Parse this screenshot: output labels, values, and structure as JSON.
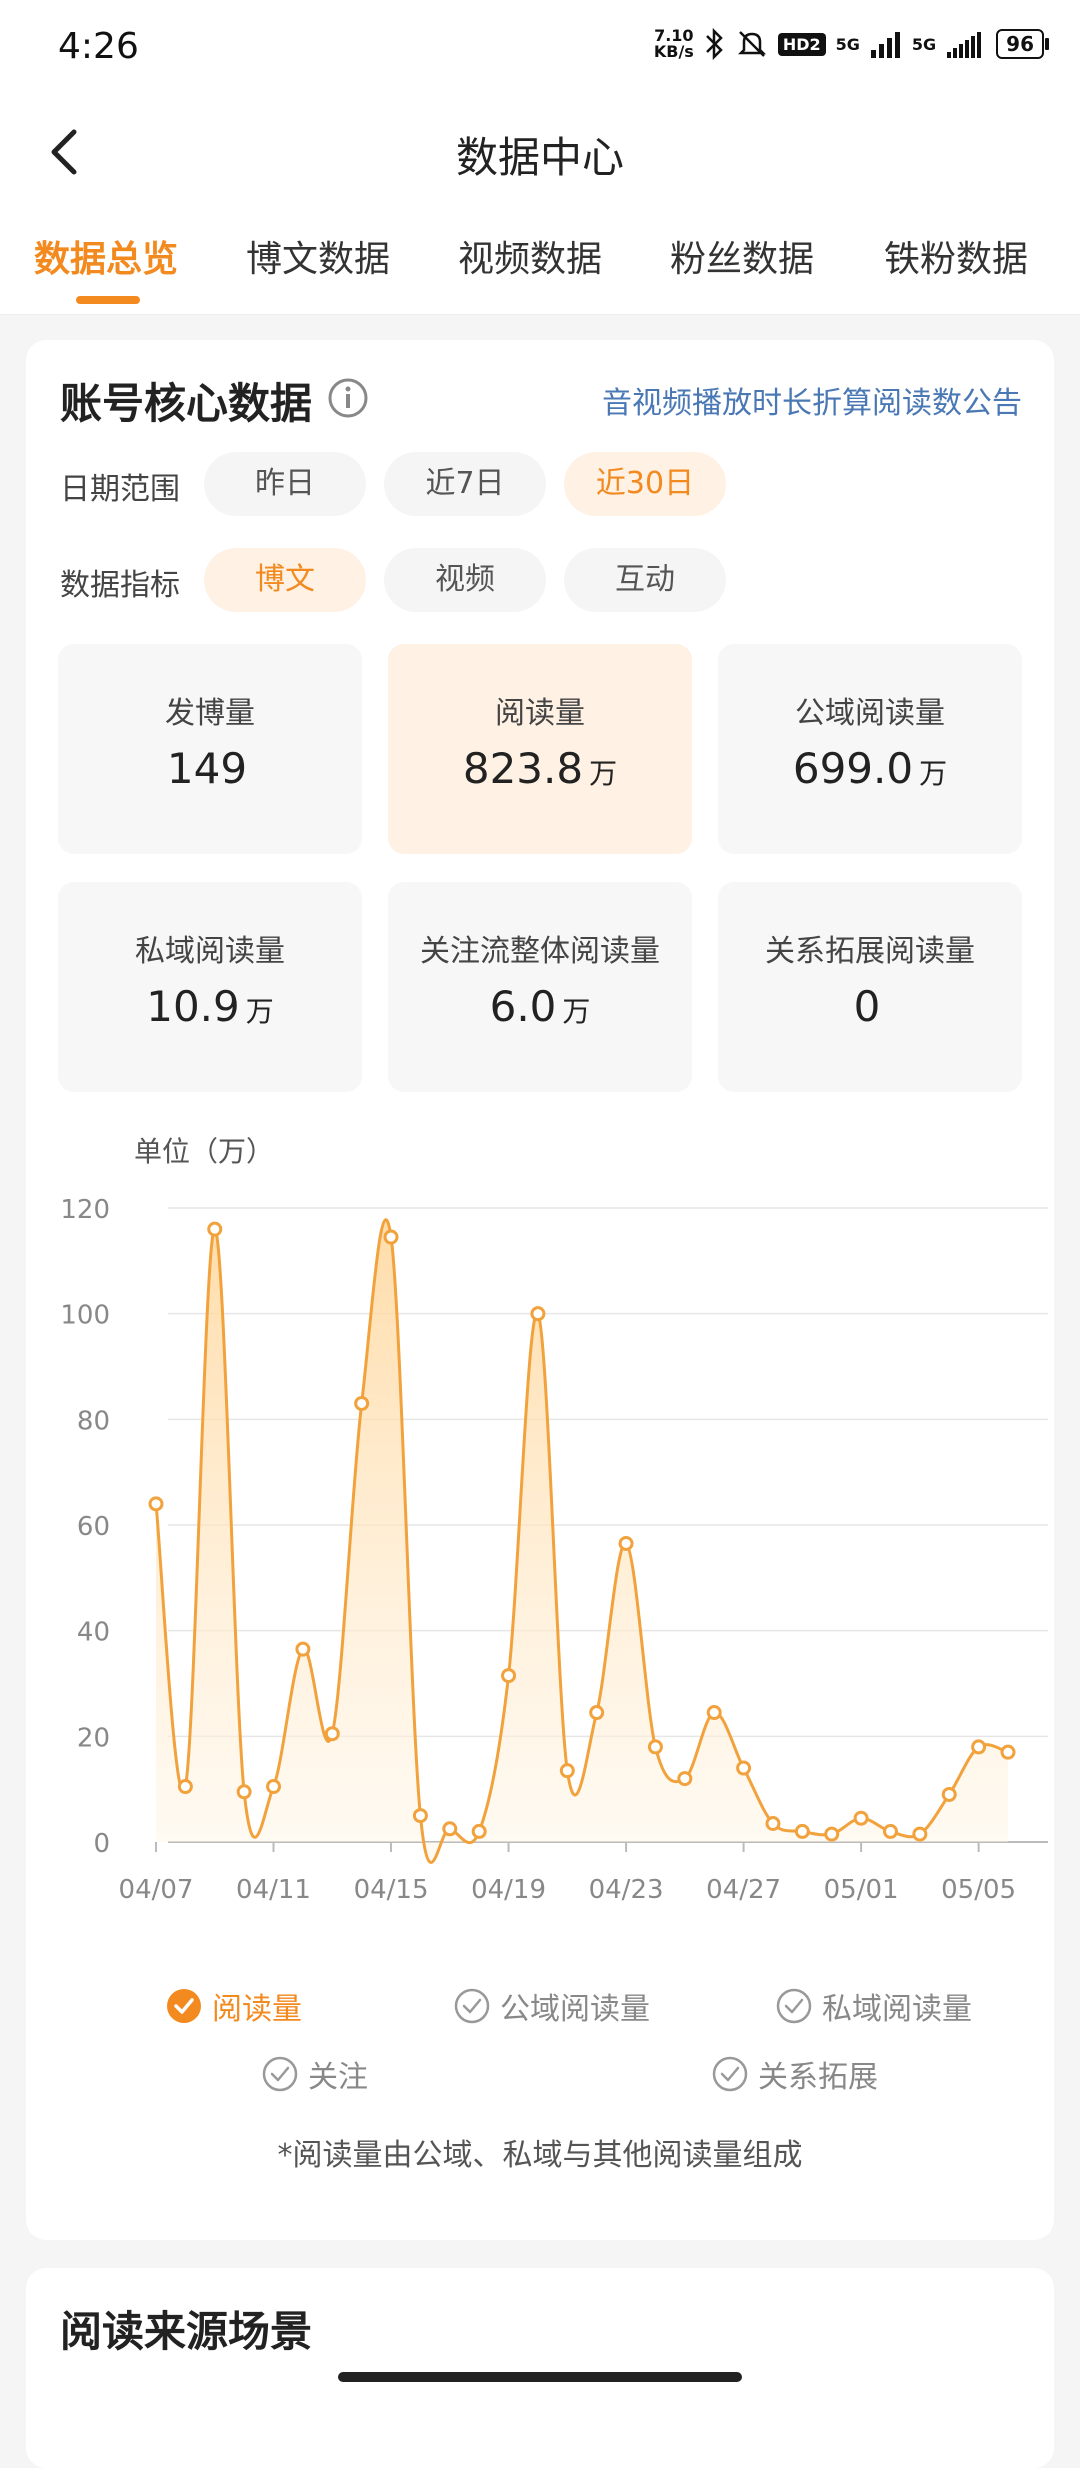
{
  "status_bar": {
    "time": "4:26",
    "net_speed": "7.10\nKB/s",
    "hd": "HD2",
    "net1": "5G",
    "net2": "5G",
    "battery": "96"
  },
  "header": {
    "title": "数据中心"
  },
  "tabs": [
    {
      "label": "数据总览",
      "active": true
    },
    {
      "label": "博文数据",
      "active": false
    },
    {
      "label": "视频数据",
      "active": false
    },
    {
      "label": "粉丝数据",
      "active": false
    },
    {
      "label": "铁粉数据",
      "active": false
    }
  ],
  "core": {
    "title": "账号核心数据",
    "notice_link": "音视频播放时长折算阅读数公告",
    "date_range": {
      "label": "日期范围",
      "options": [
        "昨日",
        "近7日",
        "近30日"
      ],
      "selected": "近30日"
    },
    "metric_type": {
      "label": "数据指标",
      "options": [
        "博文",
        "视频",
        "互动"
      ],
      "selected": "博文"
    },
    "metrics": [
      {
        "label": "发博量",
        "value": "149",
        "unit": ""
      },
      {
        "label": "阅读量",
        "value": "823.8",
        "unit": "万"
      },
      {
        "label": "公域阅读量",
        "value": "699.0",
        "unit": "万"
      },
      {
        "label": "私域阅读量",
        "value": "10.9",
        "unit": "万"
      },
      {
        "label": "关注流整体阅读量",
        "value": "6.0",
        "unit": "万"
      },
      {
        "label": "关系拓展阅读量",
        "value": "0",
        "unit": ""
      }
    ],
    "legend": [
      {
        "label": "阅读量",
        "active": true
      },
      {
        "label": "公域阅读量",
        "active": false
      },
      {
        "label": "私域阅读量",
        "active": false
      },
      {
        "label": "关注",
        "active": false
      },
      {
        "label": "关系拓展",
        "active": false
      }
    ],
    "footnote": "*阅读量由公域、私域与其他阅读量组成"
  },
  "chart_data": {
    "type": "area",
    "unit_label": "单位（万）",
    "x_tick_labels": [
      "04/07",
      "04/11",
      "04/15",
      "04/19",
      "04/23",
      "04/27",
      "05/01",
      "05/05"
    ],
    "ylim": [
      0,
      120
    ],
    "y_ticks": [
      0,
      20,
      40,
      60,
      80,
      100,
      120
    ],
    "grid": true,
    "series": [
      {
        "name": "阅读量",
        "color": "#f2a23c",
        "values": [
          64,
          10.5,
          116,
          9.5,
          10.5,
          36.5,
          20.5,
          83,
          114.5,
          5,
          2.5,
          2,
          31.5,
          100,
          13.5,
          24.5,
          56.5,
          18,
          12,
          24.5,
          14,
          3.5,
          2,
          1.5,
          4.5,
          2,
          1.5,
          9,
          18,
          17
        ]
      }
    ]
  },
  "section2": {
    "title": "阅读来源场景"
  }
}
